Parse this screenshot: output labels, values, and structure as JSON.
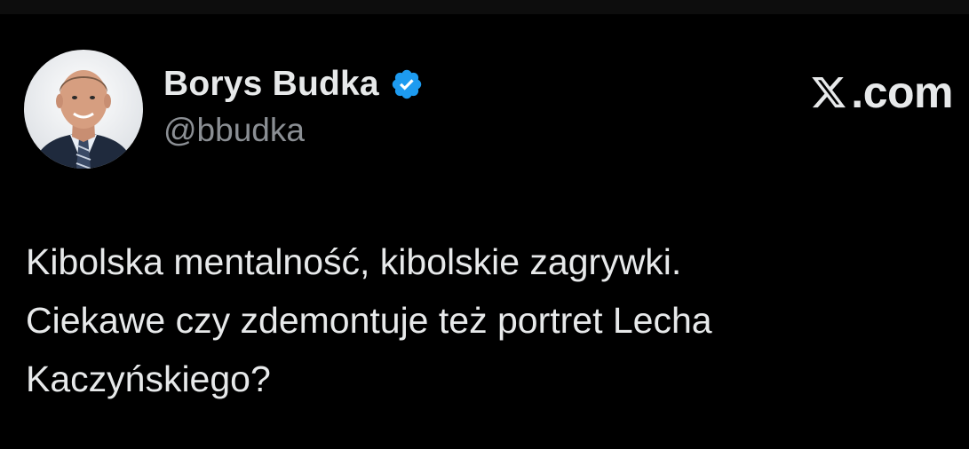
{
  "author": {
    "display_name": "Borys Budka",
    "handle": "@bbudka",
    "verified": true,
    "verified_icon": "verified-badge-icon",
    "verified_color": "#1d9bf0"
  },
  "brand": {
    "label": ".com",
    "icon": "x-logo-icon"
  },
  "tweet": {
    "lines": [
      "Kibolska mentalność, kibolskie zagrywki.",
      "Ciekawe czy zdemontuje też portret Lecha",
      "Kaczyńskiego?"
    ]
  },
  "colors": {
    "background": "#000000",
    "text": "#e7e9ea",
    "secondary_text": "#8b8f94"
  }
}
